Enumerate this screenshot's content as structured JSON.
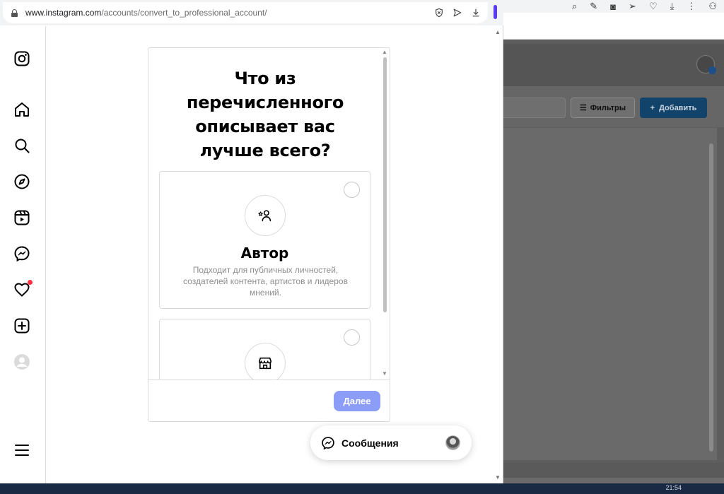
{
  "browser": {
    "url_host": "www.instagram.com",
    "url_path": "/accounts/convert_to_professional_account/"
  },
  "sidebar": {
    "items": [
      {
        "icon": "instagram-logo-icon"
      },
      {
        "icon": "home-icon"
      },
      {
        "icon": "search-icon"
      },
      {
        "icon": "explore-compass-icon"
      },
      {
        "icon": "reels-icon"
      },
      {
        "icon": "messenger-icon"
      },
      {
        "icon": "heart-icon",
        "notification": true
      },
      {
        "icon": "create-plus-icon"
      },
      {
        "icon": "profile-avatar-icon"
      },
      {
        "icon": "menu-icon"
      }
    ]
  },
  "dialog": {
    "title": "Что из перечисленного описывает вас лучше всего?",
    "options": [
      {
        "icon": "creator-icon",
        "title": "Автор",
        "description": "Подходит для публичных личностей, создателей контента, артистов и лидеров мнений."
      },
      {
        "icon": "storefront-icon"
      }
    ],
    "next_label": "Далее",
    "next_color": "#8c9df8"
  },
  "messages": {
    "label": "Сообщения"
  },
  "background_app": {
    "filters_label": "Фильтры",
    "add_label": "Добавить",
    "add_color": "#12436b",
    "clock": "21:54"
  }
}
